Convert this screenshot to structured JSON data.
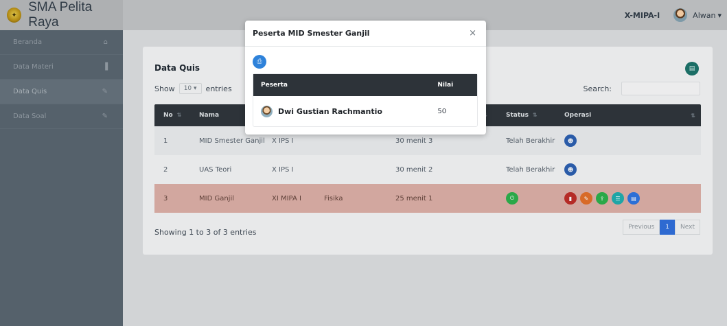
{
  "app": {
    "name": "SMA Pelita Raya",
    "logo_icon": "school-emblem-icon"
  },
  "topbar": {
    "class_label": "X-MIPA-I",
    "user_name": "Alwan",
    "caret": "▾"
  },
  "sidebar": {
    "items": [
      {
        "label": "Beranda",
        "icon": "⌂"
      },
      {
        "label": "Data Materi",
        "icon": "▐"
      },
      {
        "label": "Data Quis",
        "icon": "✎"
      },
      {
        "label": "Data Soal",
        "icon": "✎"
      }
    ]
  },
  "main": {
    "title": "Data Quis",
    "show_label": "Show",
    "entries_value": "10",
    "entries_caret": "▾",
    "entries_label": "entries",
    "search_label": "Search:",
    "columns": [
      "No",
      "Nama",
      "",
      "",
      "",
      "",
      "Status",
      "Operasi"
    ],
    "rows": [
      {
        "no": "1",
        "nama": "MID Smester Ganjil",
        "kelas": "X IPS I",
        "mapel": "",
        "waktu": "30 menit",
        "soal": "3",
        "status": "Telah Berakhir"
      },
      {
        "no": "2",
        "nama": "UAS Teori",
        "kelas": "X IPS I",
        "mapel": "",
        "waktu": "30 menit",
        "soal": "2",
        "status": "Telah Berakhir"
      },
      {
        "no": "3",
        "nama": "MID Ganjil",
        "kelas": "XI MIPA I",
        "mapel": "Fisika",
        "waktu": "25 menit",
        "soal": "1",
        "status": ""
      }
    ],
    "footer_info": "Showing 1 to 3 of 3 entries",
    "pagination": {
      "previous": "Previous",
      "current": "1",
      "next": "Next"
    }
  },
  "modal": {
    "title": "Peserta MID Smester Ganjil",
    "close": "×",
    "columns": [
      "Peserta",
      "Nilai"
    ],
    "participants": [
      {
        "name": "Dwi Gustian Rachmantio",
        "score": "50"
      }
    ]
  },
  "colors": {
    "danger_row": "#d2a79f",
    "primary": "#2e82da",
    "op_delete": "#b52b26",
    "op_edit": "#d86a28",
    "op_green": "#2aa848",
    "op_teal": "#1fa5a6",
    "op_blue": "#2c6fd6",
    "peserta_btn": "#2a5ba8"
  }
}
